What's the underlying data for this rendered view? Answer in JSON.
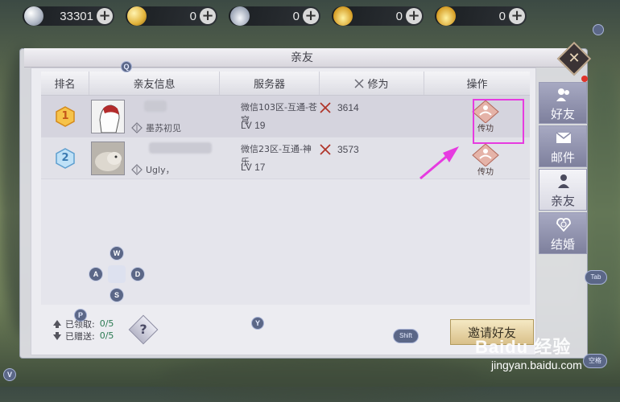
{
  "currencies": [
    {
      "icon": "silver-coin-icon",
      "value": "33301"
    },
    {
      "icon": "gold-coin-icon",
      "value": "0"
    },
    {
      "icon": "silver-ingot-icon",
      "value": "0"
    },
    {
      "icon": "gold-ingot-icon",
      "value": "0"
    },
    {
      "icon": "gold-ingot-icon",
      "value": "0"
    }
  ],
  "panel": {
    "title": "亲友",
    "headers": {
      "rank": "排名",
      "info": "亲友信息",
      "server": "服务器",
      "power": "修为",
      "op": "操作"
    },
    "rows": [
      {
        "rank": "1",
        "title": "墨苏初见",
        "server": "微信103区-互通-苍穹",
        "level": "LV 19",
        "power": "3614",
        "action": "传功"
      },
      {
        "rank": "2",
        "title": "Ugly，",
        "server": "微信23区-互通-神乐",
        "level": "LV 17",
        "power": "3573",
        "action": "传功"
      }
    ],
    "stats": {
      "received_label": "已领取:",
      "received_value": "0/5",
      "sent_label": "已赠送:",
      "sent_value": "0/5"
    },
    "help_label": "?",
    "invite_label": "邀请好友"
  },
  "tabs": [
    {
      "label": "好友",
      "icon": "friends-icon",
      "active": false
    },
    {
      "label": "邮件",
      "icon": "mail-icon",
      "active": false
    },
    {
      "label": "亲友",
      "icon": "close-friend-icon",
      "active": true
    },
    {
      "label": "结婚",
      "icon": "marriage-icon",
      "active": false
    }
  ],
  "close_label": "✕",
  "hotkeys": {
    "q": "Q",
    "p": "P",
    "y": "Y",
    "v": "V",
    "shift": "Shift",
    "tab": "Tab",
    "space": "空格",
    "w": "W",
    "a": "A",
    "s": "S",
    "d": "D"
  },
  "watermark": {
    "brand": "Baidu 经验",
    "url": "jingyan.baidu.com"
  },
  "colors": {
    "highlight": "#e63be0",
    "arrow": "#e63be0",
    "accent_green": "#2b7b52"
  }
}
